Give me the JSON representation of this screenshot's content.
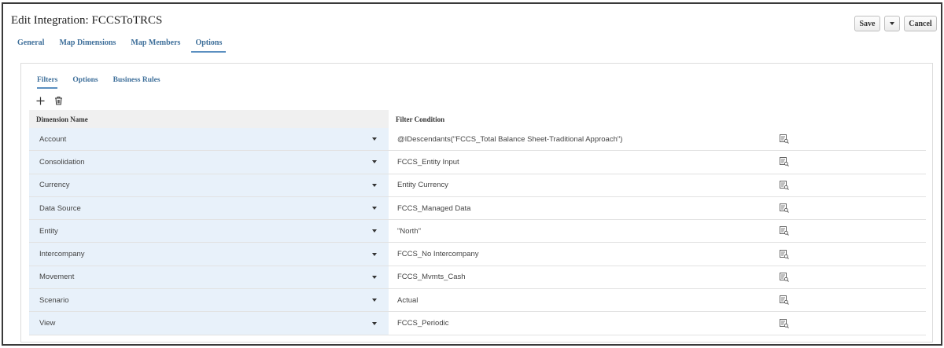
{
  "header": {
    "title": "Edit Integration: FCCSToTRCS",
    "save_label": "Save",
    "cancel_label": "Cancel"
  },
  "main_tabs": [
    {
      "label": "General"
    },
    {
      "label": "Map Dimensions"
    },
    {
      "label": "Map Members"
    },
    {
      "label": "Options",
      "active": true
    }
  ],
  "sub_tabs": [
    {
      "label": "Filters",
      "active": true
    },
    {
      "label": "Options"
    },
    {
      "label": "Business Rules"
    }
  ],
  "toolbar": {
    "icons": [
      "add-icon",
      "delete-icon"
    ]
  },
  "grid": {
    "columns": [
      "Dimension Name",
      "Filter Condition"
    ],
    "rows": [
      {
        "dimension": "Account",
        "filter": "@IDescendants(\"FCCS_Total Balance Sheet-Traditional Approach\")"
      },
      {
        "dimension": "Consolidation",
        "filter": "FCCS_Entity Input"
      },
      {
        "dimension": "Currency",
        "filter": "Entity Currency"
      },
      {
        "dimension": "Data Source",
        "filter": "FCCS_Managed Data"
      },
      {
        "dimension": "Entity",
        "filter": "\"North\""
      },
      {
        "dimension": "Intercompany",
        "filter": "FCCS_No Intercompany"
      },
      {
        "dimension": "Movement",
        "filter": "FCCS_Mvmts_Cash"
      },
      {
        "dimension": "Scenario",
        "filter": "Actual"
      },
      {
        "dimension": "View",
        "filter": "FCCS_Periodic"
      }
    ]
  },
  "colors": {
    "accent": "#3e6f9a",
    "tab_underline": "#5b8fc0",
    "dimension_cell_bg": "#e8f1fa"
  }
}
